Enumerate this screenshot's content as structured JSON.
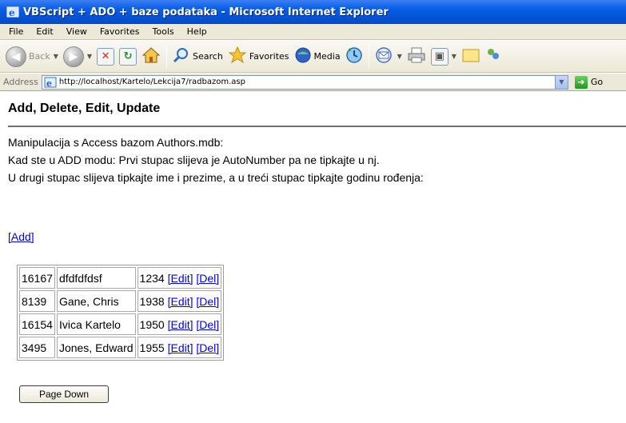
{
  "window": {
    "title": "VBScript + ADO + baze podataka - Microsoft Internet Explorer"
  },
  "menu": [
    "File",
    "Edit",
    "View",
    "Favorites",
    "Tools",
    "Help"
  ],
  "toolbar": {
    "back_label": "Back",
    "search_label": "Search",
    "favorites_label": "Favorites",
    "media_label": "Media"
  },
  "address_bar": {
    "label": "Address",
    "url": "http://localhost/Kartelo/Lekcija7/radbazom.asp",
    "go_label": "Go"
  },
  "page": {
    "heading": "Add, Delete, Edit, Update",
    "intro_lines": [
      "Manipulacija s Access bazom Authors.mdb:",
      "Kad ste u ADD modu: Prvi stupac slijeva je AutoNumber pa ne tipkajte u nj.",
      "U drugi stupac slijeva tipkajte ime i prezime, a u treći stupac tipkajte godinu rođenja:"
    ],
    "add_link": "[Add]",
    "edit_link": "[Edit]",
    "del_link": "[Del]",
    "rows": [
      {
        "id": "16167",
        "name": "dfdfdfdsf",
        "year": "1234"
      },
      {
        "id": "8139",
        "name": "Gane, Chris",
        "year": "1938"
      },
      {
        "id": "16154",
        "name": "Ivica Kartelo",
        "year": "1950"
      },
      {
        "id": "3495",
        "name": "Jones, Edward",
        "year": "1955"
      }
    ],
    "page_down_label": "Page Down"
  }
}
